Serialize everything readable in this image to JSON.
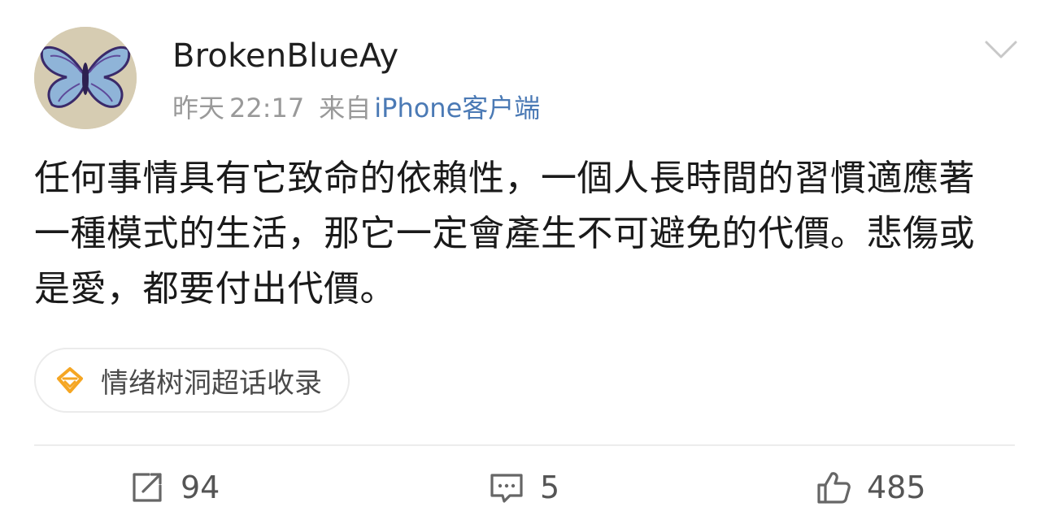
{
  "post": {
    "username": "BrokenBlueAy",
    "date_label": "昨天",
    "time": "22:17",
    "source_prefix": "来自",
    "source_client": "iPhone客户端",
    "body": "任何事情具有它致命的依賴性，一個人長時間的習慣適應著一種模式的生活，那它一定會產生不可避免的代價。悲傷或是愛，都要付出代價。",
    "avatar_icon": "butterfly-avatar",
    "menu_icon": "chevron-down-icon"
  },
  "topic": {
    "icon": "supertopic-diamond-icon",
    "label": "情绪树洞超话收录",
    "icon_color": "#f5a623"
  },
  "actions": {
    "repost": {
      "icon": "repost-icon",
      "count": "94"
    },
    "comment": {
      "icon": "comment-icon",
      "count": "5"
    },
    "like": {
      "icon": "thumbs-up-icon",
      "count": "485"
    }
  },
  "colors": {
    "link": "#4b7ab5",
    "meta_gray": "#999999",
    "text": "#1a1a1a"
  }
}
